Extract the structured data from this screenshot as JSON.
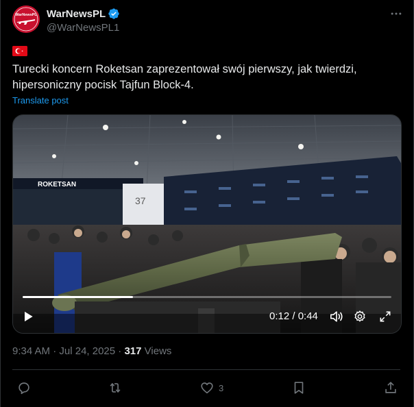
{
  "author": {
    "display_name": "WarNewsPL",
    "handle": "@WarNewsPL1",
    "avatar_text": "WarNewsPL"
  },
  "post": {
    "flag": "turkey-flag",
    "text": "Turecki koncern Roketsan zaprezentował swój pierwszy, jak twierdzi, hipersoniczny pocisk Tajfun Block-4.",
    "translate_label": "Translate post"
  },
  "video": {
    "time_display": "0:12 / 0:44",
    "progress": 0.3,
    "banner_text": "ROKETSAN",
    "stand_number": "37"
  },
  "meta": {
    "time": "9:34 AM",
    "separator": " · ",
    "date": "Jul 24, 2025",
    "views_count": "317",
    "views_label": " Views"
  },
  "actions": {
    "reply_count": "",
    "repost_count": "",
    "like_count": "3",
    "bookmark_count": ""
  },
  "colors": {
    "accent": "#1d9bf0",
    "background": "#000000",
    "text": "#e7e9ea",
    "muted": "#71767b",
    "border": "#2f3336"
  }
}
